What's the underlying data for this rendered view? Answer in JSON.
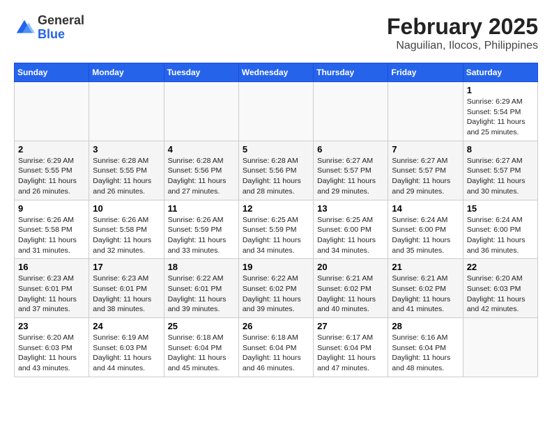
{
  "header": {
    "logo": {
      "general": "General",
      "blue": "Blue"
    },
    "title": "February 2025",
    "location": "Naguilian, Ilocos, Philippines"
  },
  "weekdays": [
    "Sunday",
    "Monday",
    "Tuesday",
    "Wednesday",
    "Thursday",
    "Friday",
    "Saturday"
  ],
  "weeks": [
    [
      {
        "day": null
      },
      {
        "day": null
      },
      {
        "day": null
      },
      {
        "day": null
      },
      {
        "day": null
      },
      {
        "day": null
      },
      {
        "day": "1",
        "sunrise": "6:29 AM",
        "sunset": "5:54 PM",
        "daylight": "11 hours and 25 minutes."
      }
    ],
    [
      {
        "day": "2",
        "sunrise": "6:29 AM",
        "sunset": "5:55 PM",
        "daylight": "11 hours and 26 minutes."
      },
      {
        "day": "3",
        "sunrise": "6:28 AM",
        "sunset": "5:55 PM",
        "daylight": "11 hours and 26 minutes."
      },
      {
        "day": "4",
        "sunrise": "6:28 AM",
        "sunset": "5:56 PM",
        "daylight": "11 hours and 27 minutes."
      },
      {
        "day": "5",
        "sunrise": "6:28 AM",
        "sunset": "5:56 PM",
        "daylight": "11 hours and 28 minutes."
      },
      {
        "day": "6",
        "sunrise": "6:27 AM",
        "sunset": "5:57 PM",
        "daylight": "11 hours and 29 minutes."
      },
      {
        "day": "7",
        "sunrise": "6:27 AM",
        "sunset": "5:57 PM",
        "daylight": "11 hours and 29 minutes."
      },
      {
        "day": "8",
        "sunrise": "6:27 AM",
        "sunset": "5:57 PM",
        "daylight": "11 hours and 30 minutes."
      }
    ],
    [
      {
        "day": "9",
        "sunrise": "6:26 AM",
        "sunset": "5:58 PM",
        "daylight": "11 hours and 31 minutes."
      },
      {
        "day": "10",
        "sunrise": "6:26 AM",
        "sunset": "5:58 PM",
        "daylight": "11 hours and 32 minutes."
      },
      {
        "day": "11",
        "sunrise": "6:26 AM",
        "sunset": "5:59 PM",
        "daylight": "11 hours and 33 minutes."
      },
      {
        "day": "12",
        "sunrise": "6:25 AM",
        "sunset": "5:59 PM",
        "daylight": "11 hours and 34 minutes."
      },
      {
        "day": "13",
        "sunrise": "6:25 AM",
        "sunset": "6:00 PM",
        "daylight": "11 hours and 34 minutes."
      },
      {
        "day": "14",
        "sunrise": "6:24 AM",
        "sunset": "6:00 PM",
        "daylight": "11 hours and 35 minutes."
      },
      {
        "day": "15",
        "sunrise": "6:24 AM",
        "sunset": "6:00 PM",
        "daylight": "11 hours and 36 minutes."
      }
    ],
    [
      {
        "day": "16",
        "sunrise": "6:23 AM",
        "sunset": "6:01 PM",
        "daylight": "11 hours and 37 minutes."
      },
      {
        "day": "17",
        "sunrise": "6:23 AM",
        "sunset": "6:01 PM",
        "daylight": "11 hours and 38 minutes."
      },
      {
        "day": "18",
        "sunrise": "6:22 AM",
        "sunset": "6:01 PM",
        "daylight": "11 hours and 39 minutes."
      },
      {
        "day": "19",
        "sunrise": "6:22 AM",
        "sunset": "6:02 PM",
        "daylight": "11 hours and 39 minutes."
      },
      {
        "day": "20",
        "sunrise": "6:21 AM",
        "sunset": "6:02 PM",
        "daylight": "11 hours and 40 minutes."
      },
      {
        "day": "21",
        "sunrise": "6:21 AM",
        "sunset": "6:02 PM",
        "daylight": "11 hours and 41 minutes."
      },
      {
        "day": "22",
        "sunrise": "6:20 AM",
        "sunset": "6:03 PM",
        "daylight": "11 hours and 42 minutes."
      }
    ],
    [
      {
        "day": "23",
        "sunrise": "6:20 AM",
        "sunset": "6:03 PM",
        "daylight": "11 hours and 43 minutes."
      },
      {
        "day": "24",
        "sunrise": "6:19 AM",
        "sunset": "6:03 PM",
        "daylight": "11 hours and 44 minutes."
      },
      {
        "day": "25",
        "sunrise": "6:18 AM",
        "sunset": "6:04 PM",
        "daylight": "11 hours and 45 minutes."
      },
      {
        "day": "26",
        "sunrise": "6:18 AM",
        "sunset": "6:04 PM",
        "daylight": "11 hours and 46 minutes."
      },
      {
        "day": "27",
        "sunrise": "6:17 AM",
        "sunset": "6:04 PM",
        "daylight": "11 hours and 47 minutes."
      },
      {
        "day": "28",
        "sunrise": "6:16 AM",
        "sunset": "6:04 PM",
        "daylight": "11 hours and 48 minutes."
      },
      {
        "day": null
      }
    ]
  ]
}
